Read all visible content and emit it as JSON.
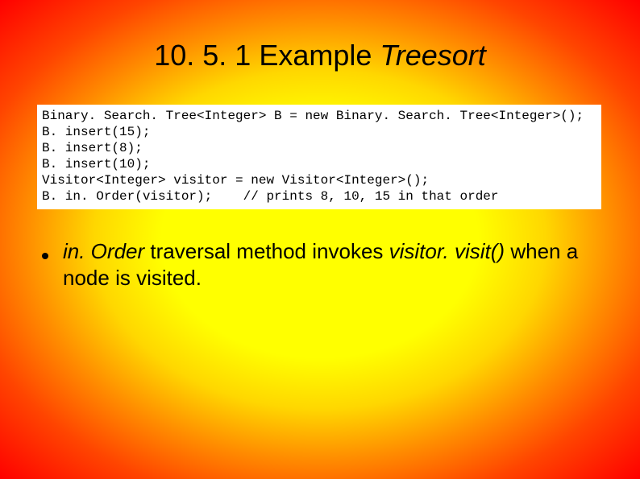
{
  "title": {
    "prefix": "10. 5. 1 Example ",
    "suffix": "Treesort"
  },
  "code": {
    "lines": [
      "Binary. Search. Tree<Integer> B = new Binary. Search. Tree<Integer>();",
      "B. insert(15);",
      "B. insert(8);",
      "B. insert(10);",
      "Visitor<Integer> visitor = new Visitor<Integer>();",
      "B. in. Order(visitor);    // prints 8, 10, 15 in that order"
    ]
  },
  "bullet": {
    "part1_italic": "in. Order",
    "part2": " traversal method invokes ",
    "part3_italic": "visitor. visit()",
    "part4": " when a node is visited."
  }
}
